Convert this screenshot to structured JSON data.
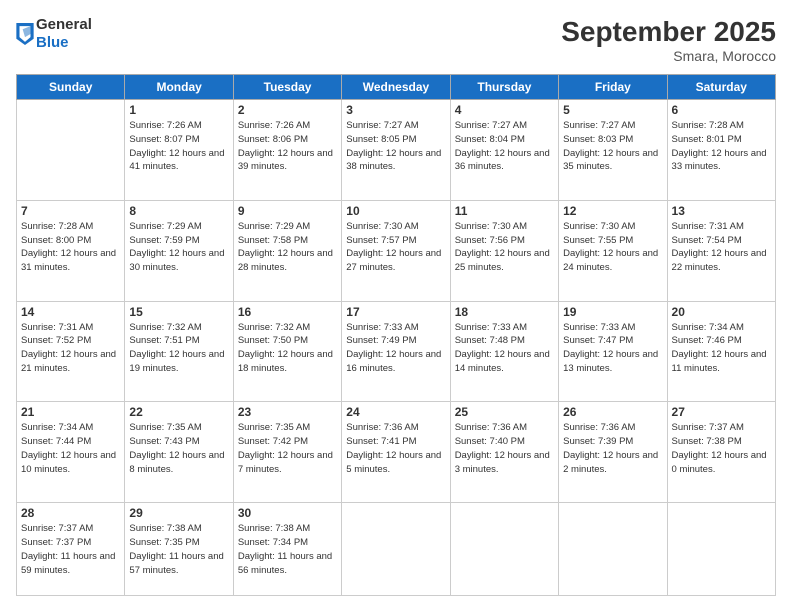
{
  "logo": {
    "general": "General",
    "blue": "Blue"
  },
  "header": {
    "month": "September 2025",
    "location": "Smara, Morocco"
  },
  "weekdays": [
    "Sunday",
    "Monday",
    "Tuesday",
    "Wednesday",
    "Thursday",
    "Friday",
    "Saturday"
  ],
  "days": [
    {
      "num": "",
      "sunrise": "",
      "sunset": "",
      "daylight": ""
    },
    {
      "num": "1",
      "sunrise": "Sunrise: 7:26 AM",
      "sunset": "Sunset: 8:07 PM",
      "daylight": "Daylight: 12 hours and 41 minutes."
    },
    {
      "num": "2",
      "sunrise": "Sunrise: 7:26 AM",
      "sunset": "Sunset: 8:06 PM",
      "daylight": "Daylight: 12 hours and 39 minutes."
    },
    {
      "num": "3",
      "sunrise": "Sunrise: 7:27 AM",
      "sunset": "Sunset: 8:05 PM",
      "daylight": "Daylight: 12 hours and 38 minutes."
    },
    {
      "num": "4",
      "sunrise": "Sunrise: 7:27 AM",
      "sunset": "Sunset: 8:04 PM",
      "daylight": "Daylight: 12 hours and 36 minutes."
    },
    {
      "num": "5",
      "sunrise": "Sunrise: 7:27 AM",
      "sunset": "Sunset: 8:03 PM",
      "daylight": "Daylight: 12 hours and 35 minutes."
    },
    {
      "num": "6",
      "sunrise": "Sunrise: 7:28 AM",
      "sunset": "Sunset: 8:01 PM",
      "daylight": "Daylight: 12 hours and 33 minutes."
    },
    {
      "num": "7",
      "sunrise": "Sunrise: 7:28 AM",
      "sunset": "Sunset: 8:00 PM",
      "daylight": "Daylight: 12 hours and 31 minutes."
    },
    {
      "num": "8",
      "sunrise": "Sunrise: 7:29 AM",
      "sunset": "Sunset: 7:59 PM",
      "daylight": "Daylight: 12 hours and 30 minutes."
    },
    {
      "num": "9",
      "sunrise": "Sunrise: 7:29 AM",
      "sunset": "Sunset: 7:58 PM",
      "daylight": "Daylight: 12 hours and 28 minutes."
    },
    {
      "num": "10",
      "sunrise": "Sunrise: 7:30 AM",
      "sunset": "Sunset: 7:57 PM",
      "daylight": "Daylight: 12 hours and 27 minutes."
    },
    {
      "num": "11",
      "sunrise": "Sunrise: 7:30 AM",
      "sunset": "Sunset: 7:56 PM",
      "daylight": "Daylight: 12 hours and 25 minutes."
    },
    {
      "num": "12",
      "sunrise": "Sunrise: 7:30 AM",
      "sunset": "Sunset: 7:55 PM",
      "daylight": "Daylight: 12 hours and 24 minutes."
    },
    {
      "num": "13",
      "sunrise": "Sunrise: 7:31 AM",
      "sunset": "Sunset: 7:54 PM",
      "daylight": "Daylight: 12 hours and 22 minutes."
    },
    {
      "num": "14",
      "sunrise": "Sunrise: 7:31 AM",
      "sunset": "Sunset: 7:52 PM",
      "daylight": "Daylight: 12 hours and 21 minutes."
    },
    {
      "num": "15",
      "sunrise": "Sunrise: 7:32 AM",
      "sunset": "Sunset: 7:51 PM",
      "daylight": "Daylight: 12 hours and 19 minutes."
    },
    {
      "num": "16",
      "sunrise": "Sunrise: 7:32 AM",
      "sunset": "Sunset: 7:50 PM",
      "daylight": "Daylight: 12 hours and 18 minutes."
    },
    {
      "num": "17",
      "sunrise": "Sunrise: 7:33 AM",
      "sunset": "Sunset: 7:49 PM",
      "daylight": "Daylight: 12 hours and 16 minutes."
    },
    {
      "num": "18",
      "sunrise": "Sunrise: 7:33 AM",
      "sunset": "Sunset: 7:48 PM",
      "daylight": "Daylight: 12 hours and 14 minutes."
    },
    {
      "num": "19",
      "sunrise": "Sunrise: 7:33 AM",
      "sunset": "Sunset: 7:47 PM",
      "daylight": "Daylight: 12 hours and 13 minutes."
    },
    {
      "num": "20",
      "sunrise": "Sunrise: 7:34 AM",
      "sunset": "Sunset: 7:46 PM",
      "daylight": "Daylight: 12 hours and 11 minutes."
    },
    {
      "num": "21",
      "sunrise": "Sunrise: 7:34 AM",
      "sunset": "Sunset: 7:44 PM",
      "daylight": "Daylight: 12 hours and 10 minutes."
    },
    {
      "num": "22",
      "sunrise": "Sunrise: 7:35 AM",
      "sunset": "Sunset: 7:43 PM",
      "daylight": "Daylight: 12 hours and 8 minutes."
    },
    {
      "num": "23",
      "sunrise": "Sunrise: 7:35 AM",
      "sunset": "Sunset: 7:42 PM",
      "daylight": "Daylight: 12 hours and 7 minutes."
    },
    {
      "num": "24",
      "sunrise": "Sunrise: 7:36 AM",
      "sunset": "Sunset: 7:41 PM",
      "daylight": "Daylight: 12 hours and 5 minutes."
    },
    {
      "num": "25",
      "sunrise": "Sunrise: 7:36 AM",
      "sunset": "Sunset: 7:40 PM",
      "daylight": "Daylight: 12 hours and 3 minutes."
    },
    {
      "num": "26",
      "sunrise": "Sunrise: 7:36 AM",
      "sunset": "Sunset: 7:39 PM",
      "daylight": "Daylight: 12 hours and 2 minutes."
    },
    {
      "num": "27",
      "sunrise": "Sunrise: 7:37 AM",
      "sunset": "Sunset: 7:38 PM",
      "daylight": "Daylight: 12 hours and 0 minutes."
    },
    {
      "num": "28",
      "sunrise": "Sunrise: 7:37 AM",
      "sunset": "Sunset: 7:37 PM",
      "daylight": "Daylight: 11 hours and 59 minutes."
    },
    {
      "num": "29",
      "sunrise": "Sunrise: 7:38 AM",
      "sunset": "Sunset: 7:35 PM",
      "daylight": "Daylight: 11 hours and 57 minutes."
    },
    {
      "num": "30",
      "sunrise": "Sunrise: 7:38 AM",
      "sunset": "Sunset: 7:34 PM",
      "daylight": "Daylight: 11 hours and 56 minutes."
    }
  ]
}
